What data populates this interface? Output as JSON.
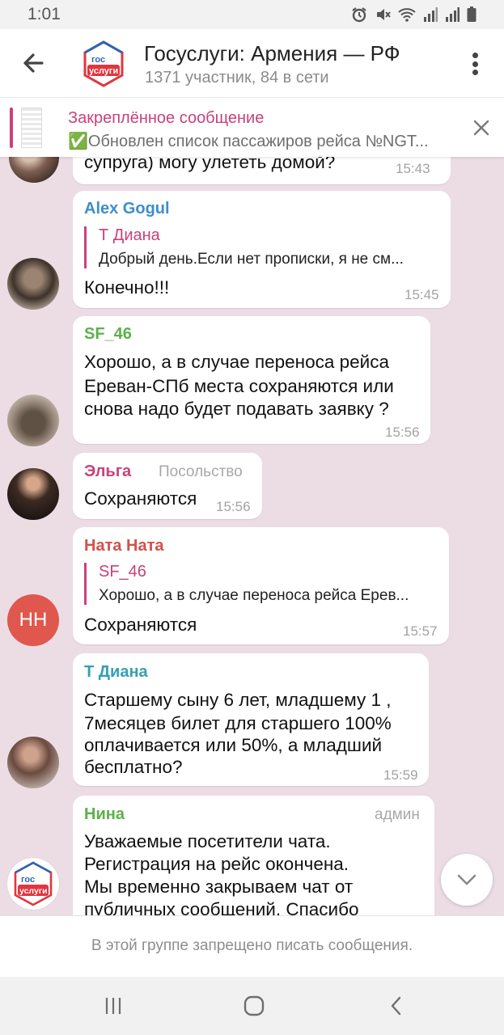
{
  "status": {
    "time": "1:01"
  },
  "header": {
    "title": "Госуслуги: Армения — РФ",
    "subtitle": "1371 участник, 84 в сети",
    "avatar_text_top": "гос",
    "avatar_text_bottom": "услуги"
  },
  "pinned": {
    "title": "Закреплённое сообщение",
    "text": "✅Обновлен список пассажиров рейса №NGT..."
  },
  "messages": {
    "m0": {
      "body": "супруга) могу улететь домой?",
      "time": "15:43"
    },
    "m1": {
      "sender": "Alex Gogul",
      "reply_name": "Т Диана",
      "reply_text": "Добрый день.Если нет прописки, я не см...",
      "body": "Конечно!!!",
      "time": "15:45"
    },
    "m2": {
      "sender": "SF_46",
      "lines": [
        "Хорошо, а в случае переноса рейса",
        "Ереван-СПб места сохраняются или",
        "снова надо будет подавать заявку ?"
      ],
      "time": "15:56"
    },
    "m3": {
      "sender": "Эльга",
      "role": "Посольство",
      "body": "Сохраняются",
      "time": "15:56"
    },
    "m4": {
      "sender": "Ната Ната",
      "initials": "НН",
      "reply_name": "SF_46",
      "reply_text": "Хорошо, а в случае переноса рейса Ерев...",
      "body": "Сохраняются",
      "time": "15:57"
    },
    "m5": {
      "sender": "Т Диана",
      "lines": [
        "Старшему сыну 6 лет, младшему 1 ,",
        "7месяцев билет для старшего 100%",
        "оплачивается или 50%, а младший",
        "бесплатно?"
      ],
      "time": "15:59"
    },
    "m6": {
      "sender": "Нина",
      "role": "админ",
      "lines": [
        "Уважаемые посетители чата.",
        "Регистрация на рейс окончена.",
        "Мы временно закрываем чат от",
        "публичных сообщений. Спасибо"
      ],
      "avatar_text_top": "гос",
      "avatar_text_bottom": "услуги"
    }
  },
  "input_bar": {
    "message": "В этой группе запрещено писать сообщения."
  },
  "colors": {
    "chat_background": "#ecdde5",
    "accent": "#c8427a",
    "name_blue": "#3d8ecb",
    "name_green": "#5bb14a",
    "name_pink": "#c8427a",
    "name_red": "#d2504a",
    "name_teal": "#34a0b3",
    "initials_avatar": "#e0574e"
  }
}
